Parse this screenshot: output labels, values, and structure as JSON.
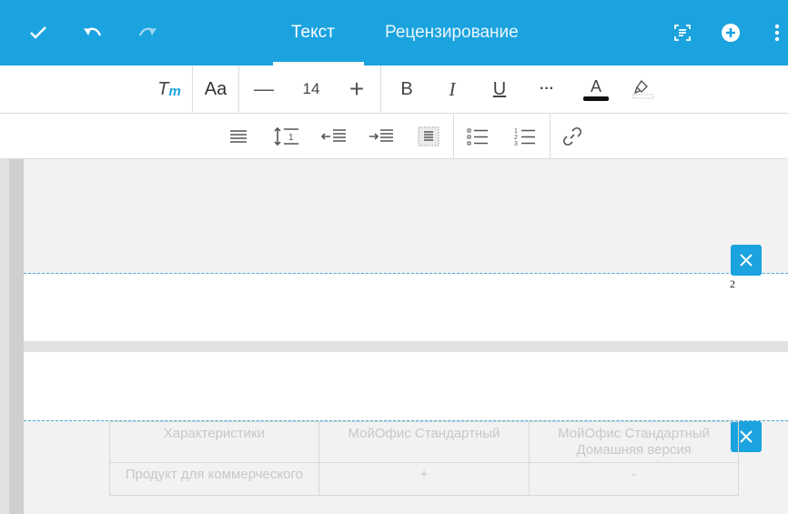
{
  "appbar": {
    "tabs": [
      {
        "label": "Текст",
        "active": true
      },
      {
        "label": "Рецензирование",
        "active": false
      }
    ],
    "icons": [
      "check-icon",
      "undo-icon",
      "redo-icon",
      "text-select-icon",
      "add-circle-icon",
      "more-vert-icon"
    ]
  },
  "toolbar1": {
    "styles_label": "Tт",
    "font_label": "Aa",
    "font_size": "14",
    "minus": "—",
    "plus": "+",
    "bold": "B",
    "italic": "I",
    "underline": "U",
    "more": "···",
    "font_color_label": "A"
  },
  "document": {
    "page_number": "2",
    "table": {
      "header": [
        "Характеристики",
        "МойОфис Стандартный",
        "МойОфис Стандартный Домашняя версия"
      ],
      "row1": [
        "Продукт для коммерческого",
        "+",
        "-"
      ]
    }
  },
  "colors": {
    "accent": "#1ba3df",
    "page_guides": "#4aa6d8"
  }
}
